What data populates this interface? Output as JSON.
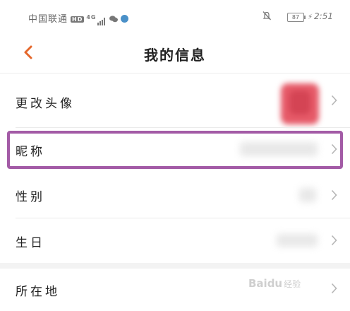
{
  "status_bar": {
    "carrier": "中国联通",
    "hd_badge": "HD",
    "network": "4G",
    "battery": "87",
    "time": "2:51",
    "icons": [
      "signal-icon",
      "wechat-icon",
      "browser-icon",
      "mute-icon",
      "battery-icon",
      "charging-icon"
    ]
  },
  "header": {
    "title": "我的信息",
    "back_icon": "chevron-left-icon"
  },
  "rows": [
    {
      "label": "更改头像"
    },
    {
      "label": "昵称"
    },
    {
      "label": "性别"
    },
    {
      "label": "生日"
    },
    {
      "label": "所在地"
    }
  ],
  "watermark": {
    "text": "Baidu",
    "sub": "经验"
  },
  "colors": {
    "accent": "#e5672b",
    "highlight": "#a35ba6",
    "chevron": "#b5b5b5"
  }
}
